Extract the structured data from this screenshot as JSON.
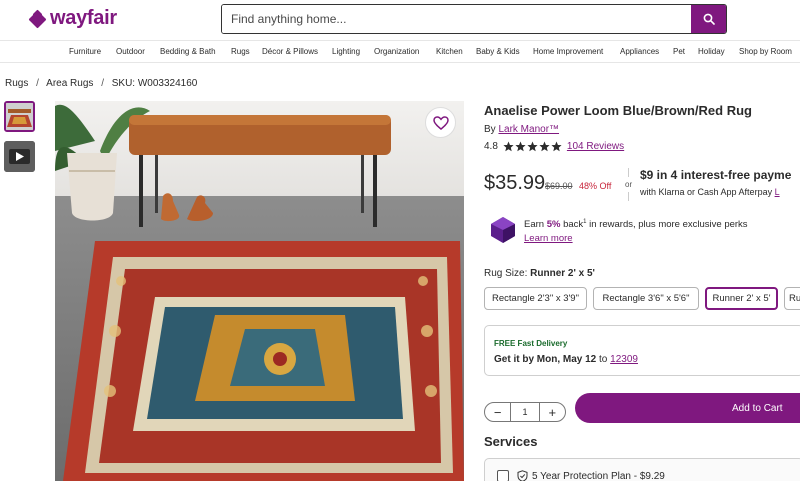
{
  "brand": {
    "name": "wayfair",
    "color": "#7f187f"
  },
  "search": {
    "placeholder": "Find anything home..."
  },
  "nav": [
    "Furniture",
    "Outdoor",
    "Bedding & Bath",
    "Rugs",
    "Décor & Pillows",
    "Lighting",
    "Organization",
    "Kitchen",
    "Baby & Kids",
    "Home Improvement",
    "Appliances",
    "Pet",
    "Holiday",
    "Shop by Room"
  ],
  "breadcrumb": {
    "items": [
      "Rugs",
      "Area Rugs",
      "SKU: W003324160"
    ],
    "separator": "/"
  },
  "product": {
    "title": "Anaelise Power Loom Blue/Brown/Red Rug",
    "by_prefix": "By",
    "brand": "Lark Manor™",
    "rating": "4.8",
    "reviews": "104 Reviews",
    "price": "$35.99",
    "was_price": "$69.00",
    "discount": "48% Off",
    "or": "or",
    "installment_title": "$9 in 4 interest-free payme",
    "installment_sub": "with Klarna or Cash App Afterpay",
    "installment_link": "L"
  },
  "rewards": {
    "earn": "Earn",
    "percent": "5%",
    "back": "back",
    "sup": "1",
    "rest": "in rewards, plus more exclusive perks",
    "learn_more": "Learn more"
  },
  "size": {
    "label": "Rug Size:",
    "selected": "Runner 2' x 5'",
    "options": [
      "Rectangle 2'3\" x 3'9\"",
      "Rectangle 3'6\" x 5'6\"",
      "Runner 2' x 5'",
      "Ru"
    ]
  },
  "delivery": {
    "badge": "FREE Fast Delivery",
    "get_it": "Get it by Mon, May 12",
    "to": "to",
    "zip": "12309"
  },
  "quantity": {
    "minus": "−",
    "value": "1",
    "plus": "+"
  },
  "cart": {
    "label": "Add to Cart"
  },
  "services": {
    "heading": "Services",
    "plan": "5 Year Protection Plan - $9.29"
  },
  "icons": [
    "search-icon",
    "heart-icon",
    "play-icon",
    "star-icon",
    "rewards-gem-icon",
    "shield-icon"
  ]
}
